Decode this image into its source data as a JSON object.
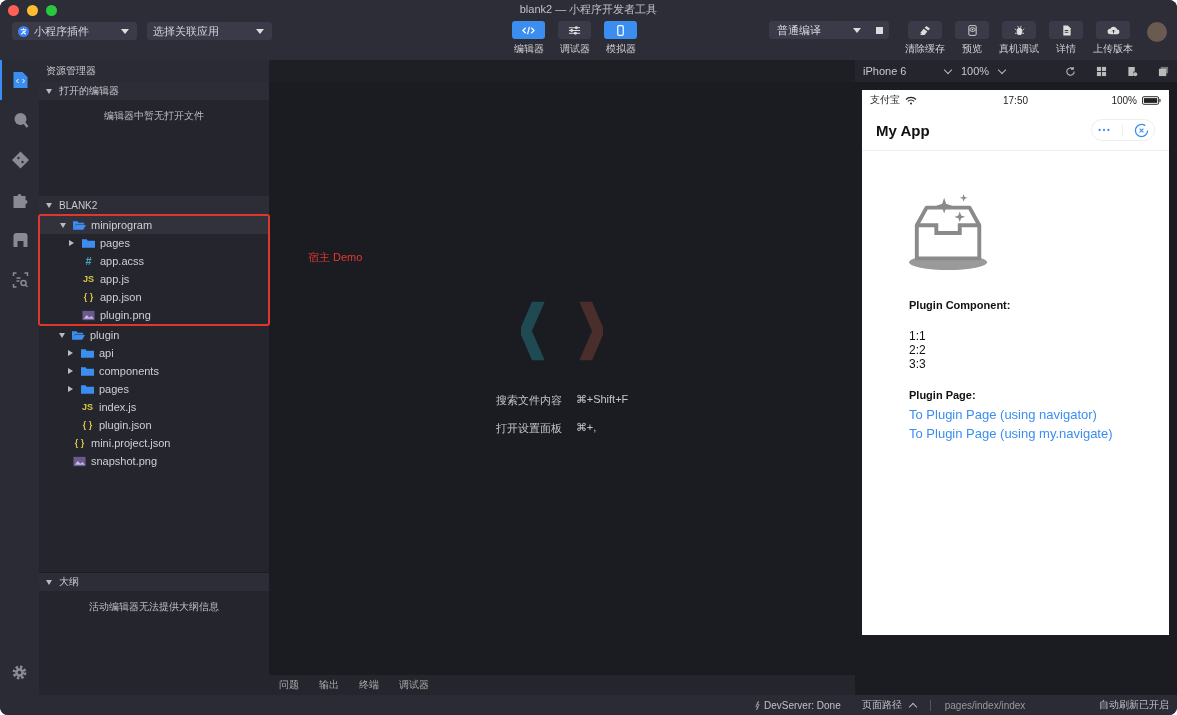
{
  "window": {
    "title": "blank2 — 小程序开发者工具"
  },
  "toolbar": {
    "project": "小程序插件",
    "app_select": "选择关联应用",
    "modes": [
      {
        "label": "编辑器",
        "kind": "code",
        "on": true
      },
      {
        "label": "调试器",
        "kind": "sliders",
        "on": false
      },
      {
        "label": "模拟器",
        "kind": "phone",
        "on": true
      }
    ],
    "compile": "普通编译",
    "actions": [
      {
        "label": "清除缓存",
        "kind": "brush"
      },
      {
        "label": "预览",
        "kind": "preview"
      },
      {
        "label": "真机调试",
        "kind": "bug"
      },
      {
        "label": "详情",
        "kind": "doc"
      },
      {
        "label": "上传版本",
        "kind": "upload"
      }
    ]
  },
  "activity_bar": [
    {
      "kind": "files",
      "selected": true
    },
    {
      "kind": "search",
      "selected": false
    },
    {
      "kind": "git",
      "selected": false
    },
    {
      "kind": "puzzle",
      "selected": false
    },
    {
      "kind": "store",
      "selected": false
    },
    {
      "kind": "scan",
      "selected": false
    }
  ],
  "explorer": {
    "title": "资源管理器",
    "open_editors": {
      "title": "打开的编辑器",
      "expanded": true,
      "empty_text": "编辑器中暂无打开文件"
    },
    "project": {
      "title": "BLANK2",
      "expanded": true,
      "tree": [
        {
          "name": "miniprogram",
          "kind": "folder",
          "expanded": true,
          "selected": true,
          "highlighted": true,
          "children": [
            {
              "name": "pages",
              "kind": "folder",
              "expanded": false,
              "selected": false
            },
            {
              "name": "app.acss",
              "kind": "css",
              "glyph": "#",
              "selected": false
            },
            {
              "name": "app.js",
              "kind": "js",
              "glyph": "JS",
              "selected": false
            },
            {
              "name": "app.json",
              "kind": "json",
              "glyph": "{ }",
              "selected": false
            },
            {
              "name": "plugin.png",
              "kind": "image",
              "selected": false
            }
          ]
        },
        {
          "name": "plugin",
          "kind": "folder",
          "expanded": true,
          "selected": false,
          "highlighted": false,
          "children": [
            {
              "name": "api",
              "kind": "folder",
              "expanded": false,
              "selected": false
            },
            {
              "name": "components",
              "kind": "folder",
              "expanded": false,
              "selected": false
            },
            {
              "name": "pages",
              "kind": "folder",
              "expanded": false,
              "selected": false
            },
            {
              "name": "index.js",
              "kind": "js",
              "glyph": "JS",
              "selected": false
            },
            {
              "name": "plugin.json",
              "kind": "json",
              "glyph": "{ }",
              "selected": false
            }
          ]
        },
        {
          "name": "mini.project.json",
          "kind": "json",
          "glyph": "{ }",
          "selected": false,
          "highlighted": false
        },
        {
          "name": "snapshot.png",
          "kind": "image",
          "selected": false,
          "highlighted": false
        }
      ]
    },
    "outline": {
      "title": "大纲",
      "expanded": true,
      "empty_text": "活动编辑器无法提供大纲信息"
    }
  },
  "annotation": {
    "text": "宿主 Demo"
  },
  "editor": {
    "shortcuts": [
      {
        "label": "搜索文件内容",
        "keys": "⌘+Shift+F"
      },
      {
        "label": "打开设置面板",
        "keys": "⌘+,"
      }
    ],
    "panel_tabs": [
      "问题",
      "输出",
      "终端",
      "调试器"
    ]
  },
  "simulator": {
    "device": "iPhone 6",
    "zoom": "100%",
    "phone": {
      "carrier": "支付宝",
      "time": "17:50",
      "battery": "100%",
      "nav_title": "My App",
      "sections": [
        {
          "heading": "Plugin Component:",
          "lines": [
            "1:1",
            "2:2",
            "3:3"
          ]
        },
        {
          "heading": "Plugin Page:",
          "links": [
            "To Plugin Page (using navigator)",
            "To Plugin Page (using my.navigate)"
          ]
        }
      ]
    }
  },
  "status_bar": {
    "devserver": "DevServer: Done",
    "page_path_label": "页面路径",
    "page_path": "pages/index/index",
    "auto_refresh": "自动刷新已开启"
  }
}
